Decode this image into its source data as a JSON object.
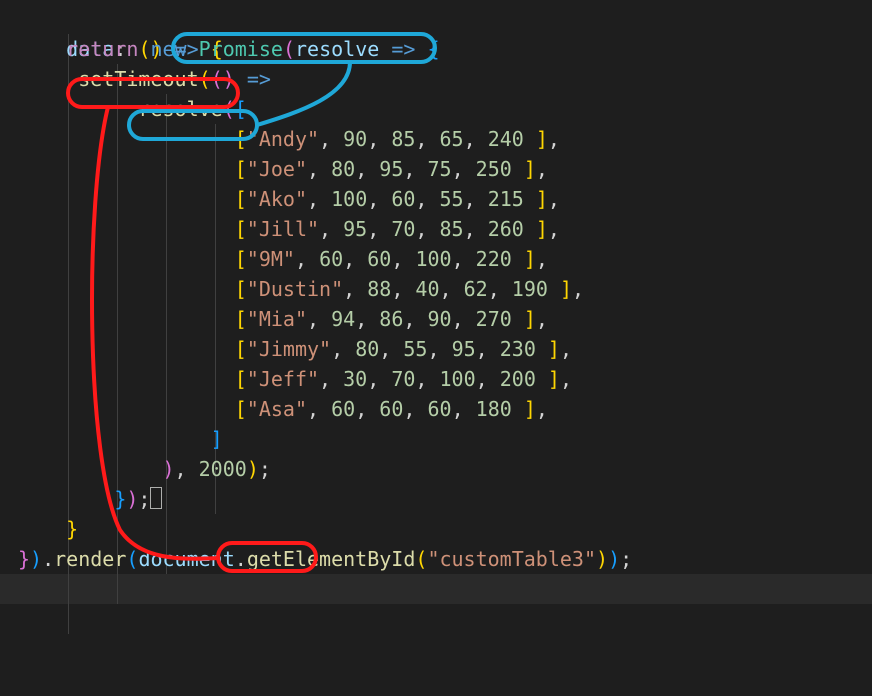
{
  "code": {
    "l1_prop": "data",
    "l1_colon": ": ",
    "l1_parens": "()",
    "l1_arrow": " =>",
    "l1_space": " ",
    "l1_brace": "{",
    "l2_return": "return",
    "l2_new": "new",
    "l2_promise": "Promise",
    "l2_resolve": "resolve",
    "l2_arrow": " =>",
    "l2_brace": "{",
    "l3_settimeout": "setTimeout",
    "l3_parens": "()",
    "l3_arrow": " =>",
    "l4_resolve": "resolve",
    "rows": [
      {
        "name": "\"Andy\"",
        "v": [
          "90",
          "85",
          "65",
          "240"
        ]
      },
      {
        "name": "\"Joe\"",
        "v": [
          "80",
          "95",
          "75",
          "250"
        ]
      },
      {
        "name": "\"Ako\"",
        "v": [
          "100",
          "60",
          "55",
          "215"
        ]
      },
      {
        "name": "\"Jill\"",
        "v": [
          "95",
          "70",
          "85",
          "260"
        ]
      },
      {
        "name": "\"9M\"",
        "v": [
          "60",
          "60",
          "100",
          "220"
        ]
      },
      {
        "name": "\"Dustin\"",
        "v": [
          "88",
          "40",
          "62",
          "190"
        ]
      },
      {
        "name": "\"Mia\"",
        "v": [
          "94",
          "86",
          "90",
          "270"
        ]
      },
      {
        "name": "\"Jimmy\"",
        "v": [
          "80",
          "55",
          "95",
          "230"
        ]
      },
      {
        "name": "\"Jeff\"",
        "v": [
          "30",
          "70",
          "100",
          "200"
        ]
      },
      {
        "name": "\"Asa\"",
        "v": [
          "60",
          "60",
          "60",
          "180"
        ]
      }
    ],
    "l17_timeout": "2000",
    "l18_semicolon": ";",
    "l20_render": "render",
    "l20_document": "document",
    "l20_getbyid": "getElementById",
    "l20_target": "\"customTable3\""
  },
  "annotations": {
    "blue": "#1fa8d8",
    "red": "#ff1a1a"
  }
}
